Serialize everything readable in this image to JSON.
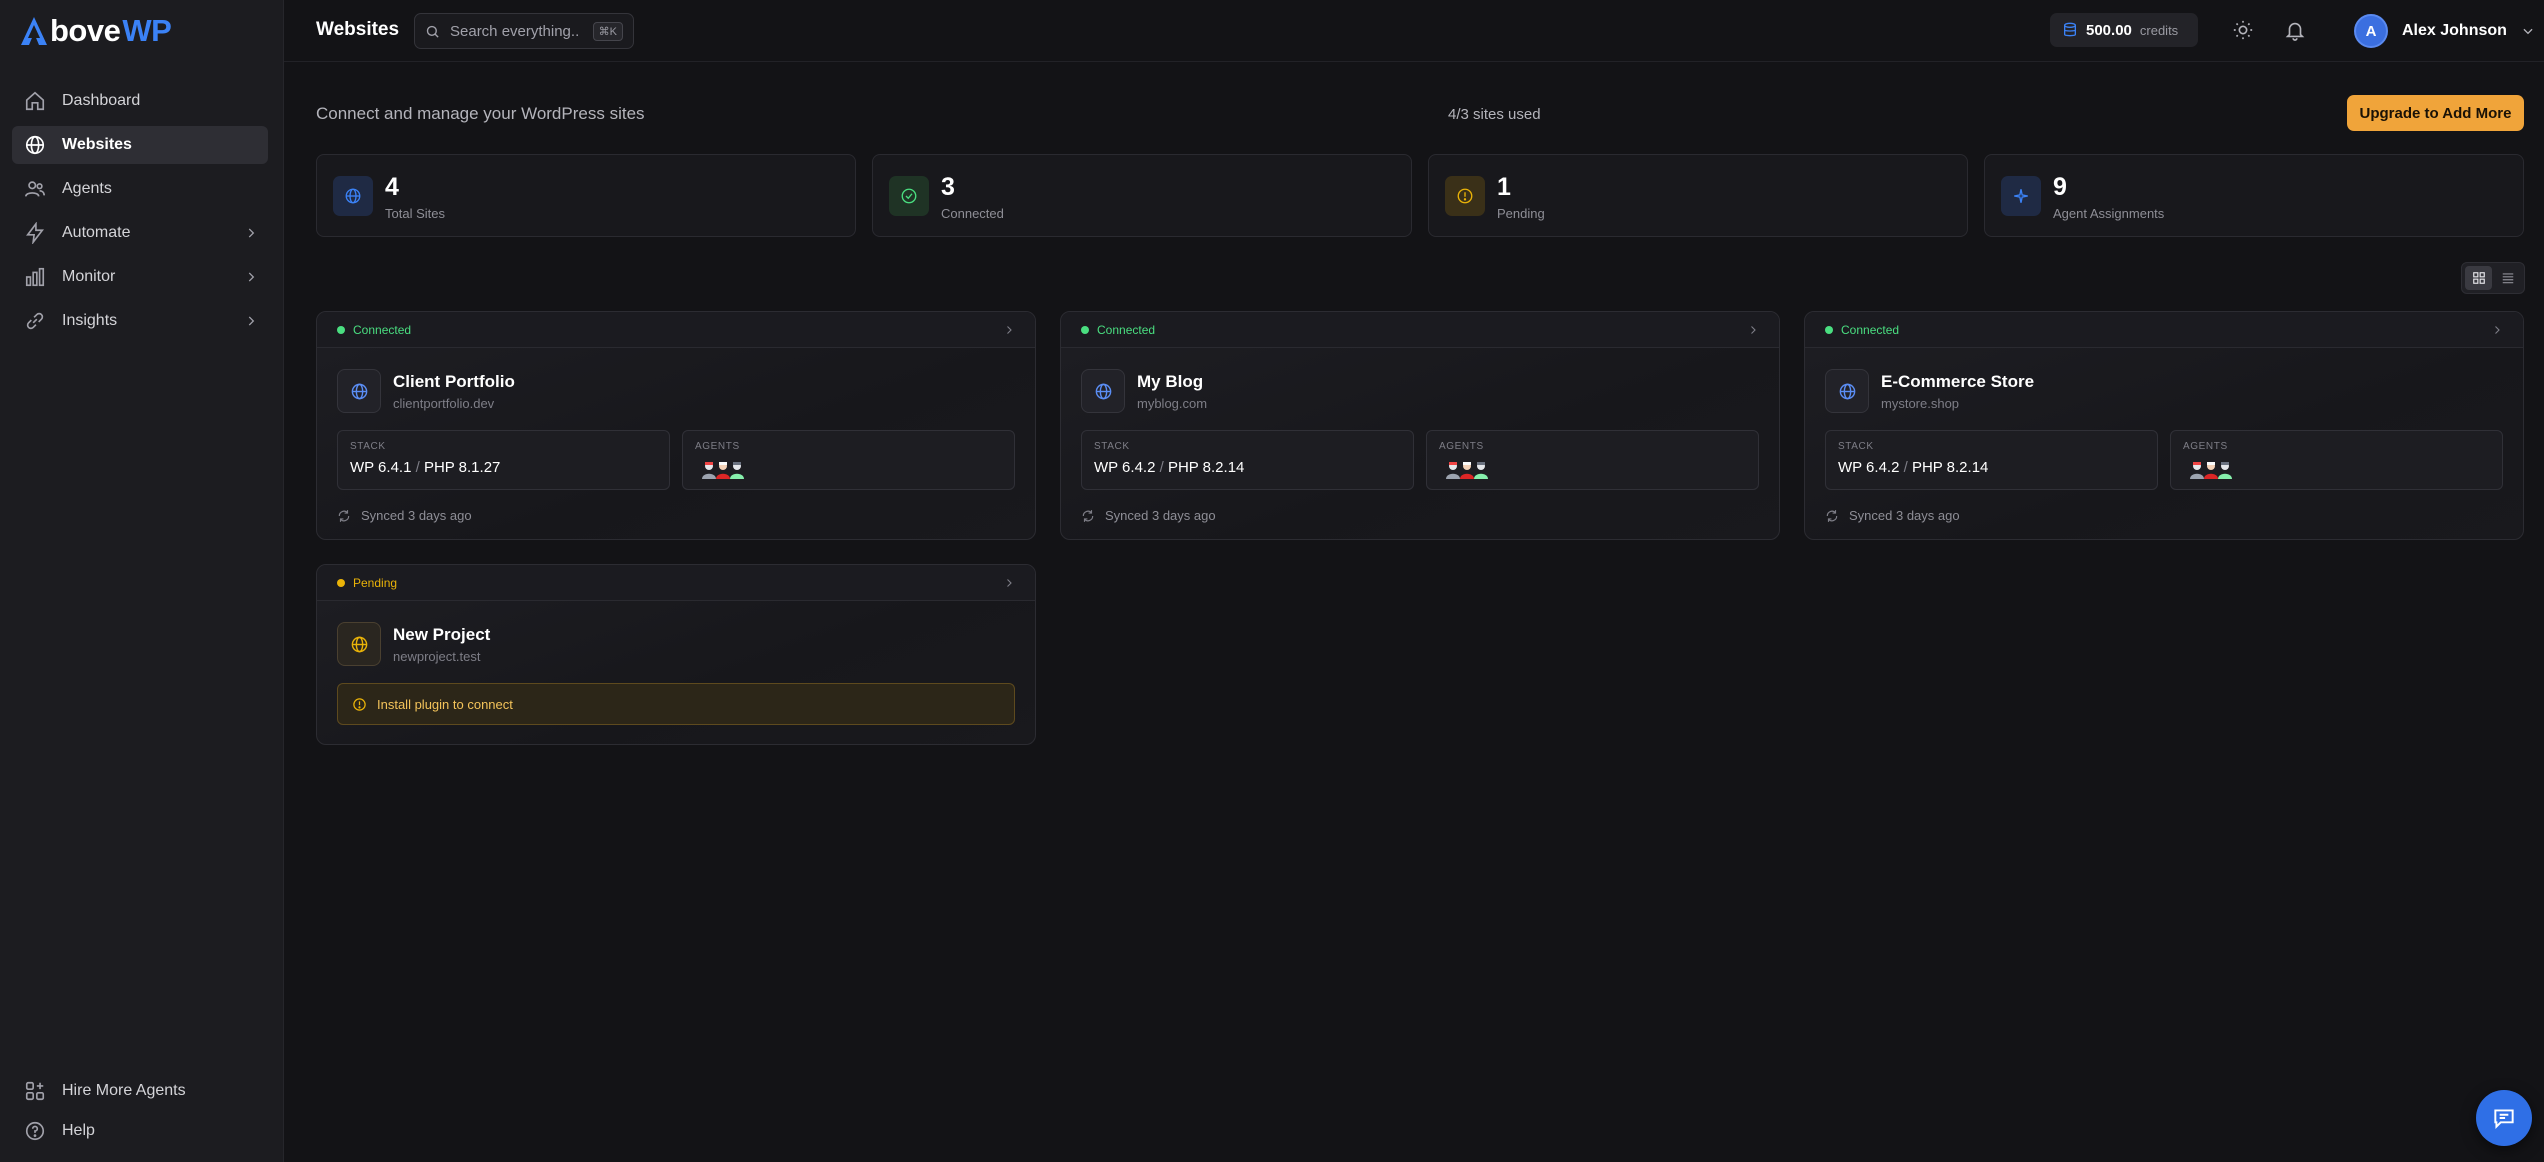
{
  "brand": {
    "logo_mark": "A",
    "logo_text": "bove",
    "logo_accent": "WP",
    "accent_color": "#3b82f6"
  },
  "sidebar": {
    "items": [
      {
        "label": "Dashboard",
        "icon": "home-icon",
        "active": false,
        "expandable": false
      },
      {
        "label": "Websites",
        "icon": "globe-icon",
        "active": true,
        "expandable": false
      },
      {
        "label": "Agents",
        "icon": "users-icon",
        "active": false,
        "expandable": false
      },
      {
        "label": "Automate",
        "icon": "bolt-icon",
        "active": false,
        "expandable": true
      },
      {
        "label": "Monitor",
        "icon": "bar-chart-icon",
        "active": false,
        "expandable": true
      },
      {
        "label": "Insights",
        "icon": "link-icon",
        "active": false,
        "expandable": true
      }
    ],
    "bottom": [
      {
        "label": "Hire More Agents",
        "icon": "grid-plus-icon"
      },
      {
        "label": "Help",
        "icon": "help-circle-icon"
      }
    ]
  },
  "header": {
    "title": "Websites",
    "search_placeholder": "Search everything...",
    "search_shortcut": "⌘K",
    "credits_amount": "500.00",
    "credits_label": "credits",
    "user_initial": "A",
    "user_name": "Alex Johnson"
  },
  "main": {
    "subtitle": "Connect and manage your WordPress sites",
    "sites_used": "4/3 sites used",
    "upgrade_label": "Upgrade to Add More",
    "upgrade_color": "#f0a43a",
    "stats": [
      {
        "value": "4",
        "label": "Total Sites",
        "icon": "globe-icon",
        "color": "#3b82f6"
      },
      {
        "value": "3",
        "label": "Connected",
        "icon": "check-circle-icon",
        "color": "#4ade80"
      },
      {
        "value": "1",
        "label": "Pending",
        "icon": "alert-circle-icon",
        "color": "#eab308"
      },
      {
        "value": "9",
        "label": "Agent Assignments",
        "icon": "sparkle-icon",
        "color": "#3b82f6"
      }
    ],
    "view_modes": [
      "grid",
      "list"
    ],
    "active_view": "grid",
    "sites": [
      {
        "status": "Connected",
        "name": "Client Portfolio",
        "domain": "clientportfolio.dev",
        "stack_label": "STACK",
        "wp": "WP 6.4.1",
        "php": "PHP 8.1.27",
        "agents_label": "AGENTS",
        "synced": "Synced 3 days ago"
      },
      {
        "status": "Connected",
        "name": "My Blog",
        "domain": "myblog.com",
        "stack_label": "STACK",
        "wp": "WP 6.4.2",
        "php": "PHP 8.2.14",
        "agents_label": "AGENTS",
        "synced": "Synced 3 days ago"
      },
      {
        "status": "Connected",
        "name": "E-Commerce Store",
        "domain": "mystore.shop",
        "stack_label": "STACK",
        "wp": "WP 6.4.2",
        "php": "PHP 8.2.14",
        "agents_label": "AGENTS",
        "synced": "Synced 3 days ago"
      },
      {
        "status": "Pending",
        "name": "New Project",
        "domain": "newproject.test",
        "notice": "Install plugin to connect"
      }
    ],
    "status_colors": {
      "connected": "#4ade80",
      "pending": "#eab308"
    }
  }
}
